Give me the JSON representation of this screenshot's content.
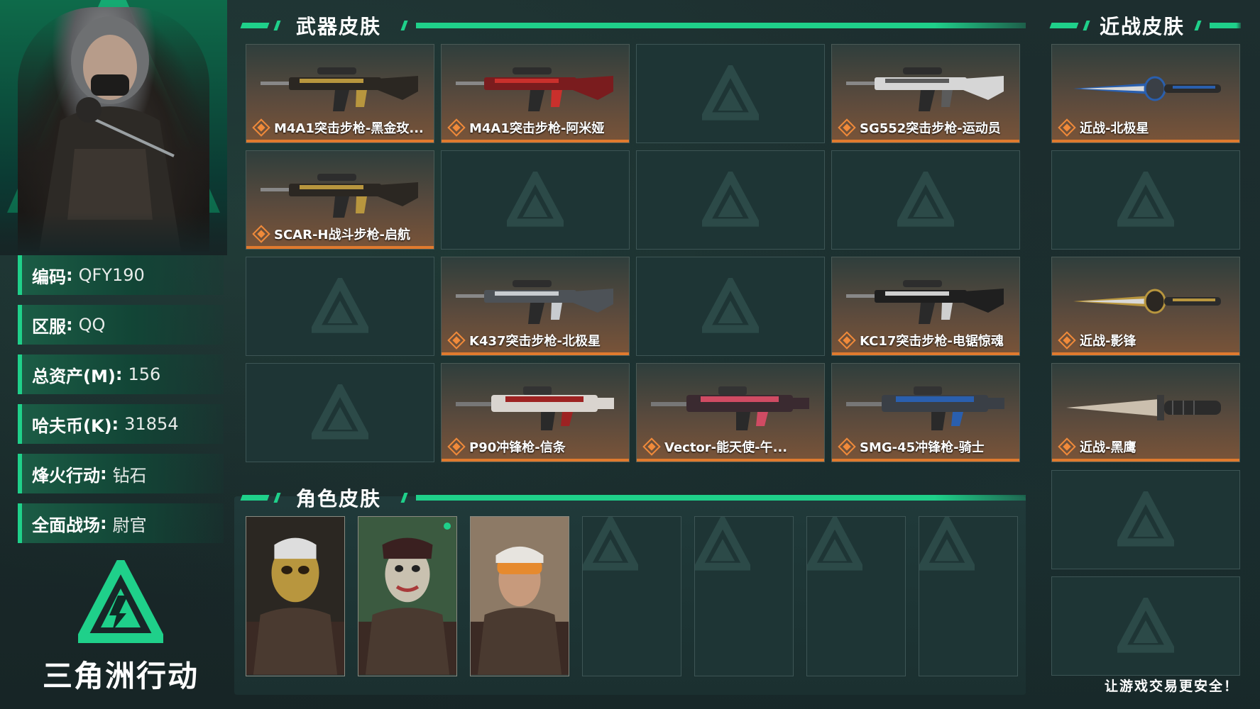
{
  "theme": {
    "accent": "#1fd08a",
    "card_bottom": "#e07a2e",
    "empty_slot": "#1e3535"
  },
  "profile": {
    "rows": [
      {
        "key": "编码",
        "value": "QFY190"
      },
      {
        "key": "区服",
        "value": "QQ"
      },
      {
        "key": "总资产(M)",
        "value": "156"
      },
      {
        "key": "哈夫币(K)",
        "value": "31854"
      },
      {
        "key": "烽火行动",
        "value": "钻石"
      },
      {
        "key": "全面战场",
        "value": "尉官"
      }
    ]
  },
  "logo": {
    "text": "三角洲行动",
    "icon": "delta-triangle-icon"
  },
  "weapon_section": {
    "title": "武器皮肤",
    "slots": [
      {
        "label": "M4A1突击步枪-黑金玫...",
        "icon": "rifle-icon",
        "tone": "gold"
      },
      {
        "label": "M4A1突击步枪-阿米娅",
        "icon": "rifle-icon",
        "tone": "red"
      },
      {
        "label": "",
        "icon": "delta-triangle-icon"
      },
      {
        "label": "SG552突击步枪-运动员",
        "icon": "rifle-icon",
        "tone": "white"
      },
      {
        "label": "SCAR-H战斗步枪-启航",
        "icon": "rifle-icon",
        "tone": "gold"
      },
      {
        "label": "",
        "icon": "delta-triangle-icon"
      },
      {
        "label": "",
        "icon": "delta-triangle-icon"
      },
      {
        "label": "",
        "icon": "delta-triangle-icon"
      },
      {
        "label": "",
        "icon": "delta-triangle-icon"
      },
      {
        "label": "K437突击步枪-北极星",
        "icon": "rifle-icon",
        "tone": "silver"
      },
      {
        "label": "",
        "icon": "delta-triangle-icon"
      },
      {
        "label": "KC17突击步枪-电锯惊魂",
        "icon": "rifle-icon",
        "tone": "dark"
      },
      {
        "label": "",
        "icon": "delta-triangle-icon"
      },
      {
        "label": "P90冲锋枪-信条",
        "icon": "smg-icon",
        "tone": "redwhite"
      },
      {
        "label": "Vector-能天使-午...",
        "icon": "smg-icon",
        "tone": "pink"
      },
      {
        "label": "SMG-45冲锋枪-骑士",
        "icon": "smg-icon",
        "tone": "blue"
      }
    ]
  },
  "melee_section": {
    "title": "近战皮肤",
    "slots": [
      {
        "label": "近战-北极星",
        "icon": "dagger-icon",
        "tone": "blue"
      },
      {
        "label": "",
        "icon": "delta-triangle-icon"
      },
      {
        "label": "近战-影锋",
        "icon": "dagger-icon",
        "tone": "gold"
      },
      {
        "label": "近战-黑鹰",
        "icon": "knife-icon",
        "tone": "silver"
      },
      {
        "label": "",
        "icon": "delta-triangle-icon"
      },
      {
        "label": "",
        "icon": "delta-triangle-icon"
      }
    ]
  },
  "character_section": {
    "title": "角色皮肤",
    "slots": [
      {
        "icon": "operator-gold-mask-icon",
        "tone": "gold"
      },
      {
        "icon": "operator-saw-mask-icon",
        "tone": "green",
        "badge": true
      },
      {
        "icon": "operator-goggles-icon",
        "tone": "beige"
      },
      {
        "icon": "delta-triangle-icon"
      },
      {
        "icon": "delta-triangle-icon"
      },
      {
        "icon": "delta-triangle-icon"
      },
      {
        "icon": "delta-triangle-icon"
      }
    ]
  },
  "footer": {
    "slogan": "让游戏交易更安全！"
  }
}
